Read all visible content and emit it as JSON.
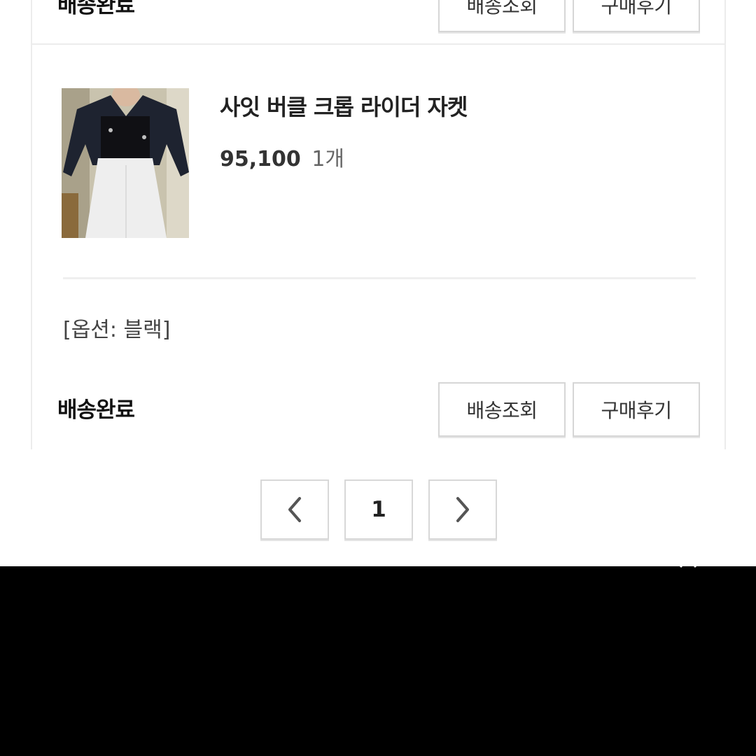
{
  "previous_order": {
    "status": "배송완료",
    "track_label": "배송조회",
    "review_label": "구매후기"
  },
  "order": {
    "product_name": "사잇 버클 크롭 라이더 자켓",
    "price": "95,100",
    "quantity": "1개",
    "option": "[옵션: 블랙]",
    "status": "배송완료",
    "track_label": "배송조회",
    "review_label": "구매후기"
  },
  "pagination": {
    "current_page": "1",
    "prev_icon": "chevron-left-icon",
    "next_icon": "chevron-right-icon"
  },
  "colors": {
    "border": "#d6d6d6",
    "text": "#222222",
    "background": "#ffffff"
  }
}
